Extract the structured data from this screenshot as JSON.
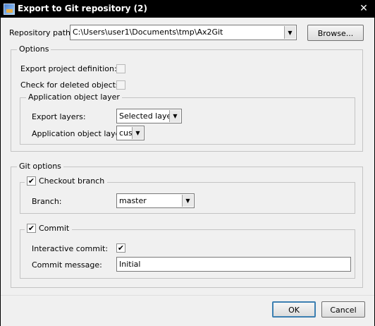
{
  "window": {
    "title": "Export to Git repository (2)",
    "close_glyph": "✕"
  },
  "repository": {
    "label": "Repository path:",
    "path": "C:\\Users\\user1\\Documents\\tmp\\Ax2Git",
    "browse_label": "Browse..."
  },
  "options": {
    "legend": "Options",
    "export_project_definition_label": "Export project definition:",
    "export_project_definition_checked": false,
    "check_deleted_label": "Check for deleted objects:",
    "check_deleted_checked": false,
    "aol": {
      "legend": "Application object layer",
      "export_layers_label": "Export layers:",
      "export_layers_value": "Selected layer",
      "aol_label": "Application object layer:",
      "aol_value": "cus"
    }
  },
  "git_options": {
    "legend": "Git options",
    "checkout": {
      "label": "Checkout branch",
      "checked": true,
      "branch_label": "Branch:",
      "branch_value": "master"
    },
    "commit": {
      "label": "Commit",
      "checked": true,
      "interactive_label": "Interactive commit:",
      "interactive_checked": true,
      "message_label": "Commit message:",
      "message_value": "Initial"
    }
  },
  "footer": {
    "ok_label": "OK",
    "cancel_label": "Cancel"
  },
  "icons": {
    "check_glyph": "✔",
    "dropdown_glyph": "▼"
  }
}
